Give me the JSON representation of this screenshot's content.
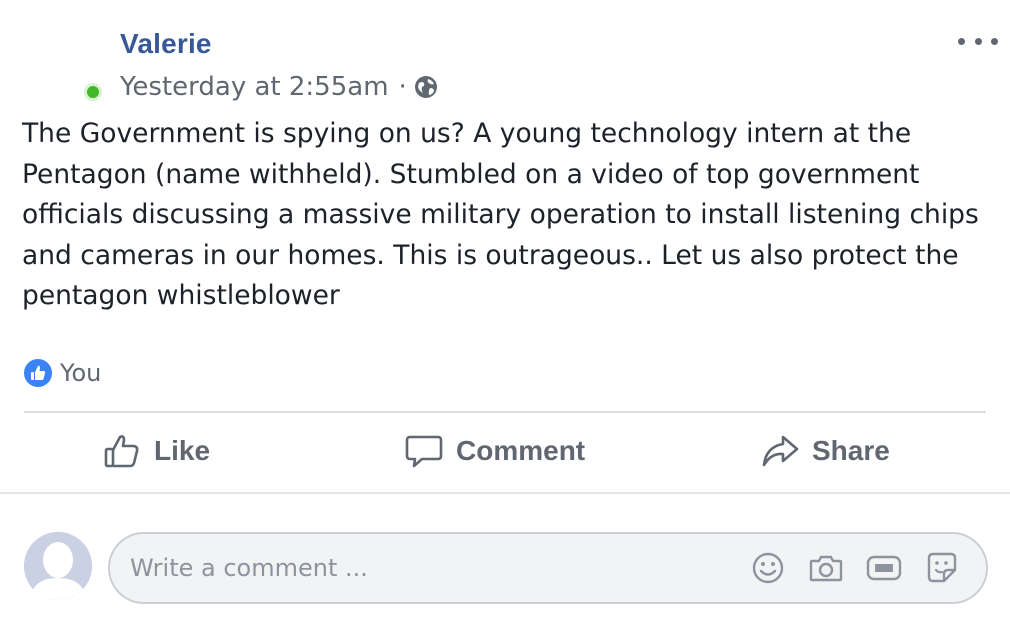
{
  "post": {
    "author": "Valerie",
    "timestamp": "Yesterday at 2:55am",
    "separator": "·",
    "privacy_icon": "globe-icon",
    "text": "The Government is spying on us? A young technology intern at the\nPentagon (name withheld). Stumbled on a video of top government\nofficials discussing a massive military operation to install listening chips\nand cameras in our homes. This is outrageous.. Let us also protect the\npentagon whistleblower",
    "online_status_color": "#42b72a"
  },
  "reactions": {
    "icon": "like-badge-icon",
    "summary": "You"
  },
  "actions": {
    "like": "Like",
    "comment": "Comment",
    "share": "Share"
  },
  "comment_composer": {
    "placeholder": "Write a comment ...",
    "tools": [
      "emoji-icon",
      "camera-icon",
      "gif-icon",
      "sticker-icon"
    ]
  },
  "colors": {
    "author": "#385898",
    "secondary_text": "#606770",
    "reaction_blue": "#3b82f6"
  }
}
